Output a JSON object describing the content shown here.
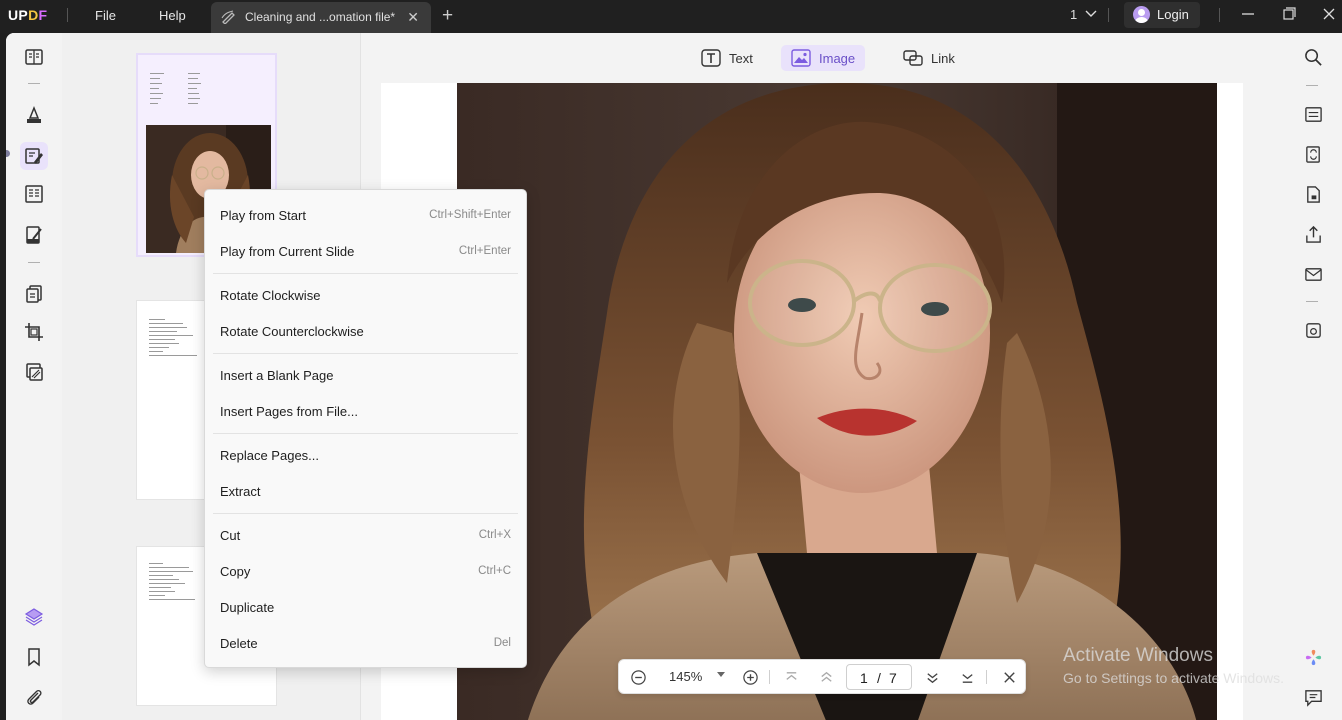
{
  "app": {
    "logo": [
      "U",
      "P",
      "D",
      "F"
    ]
  },
  "menu": {
    "file": "File",
    "help": "Help"
  },
  "tab": {
    "title": "Cleaning and ...omation file*"
  },
  "window": {
    "count": "1",
    "login": "Login"
  },
  "edit_toolbar": {
    "text": "Text",
    "image": "Image",
    "link": "Link",
    "active": "Image"
  },
  "context_menu": {
    "items": [
      {
        "label": "Play from Start",
        "shortcut": "Ctrl+Shift+Enter"
      },
      {
        "label": "Play from Current Slide",
        "shortcut": "Ctrl+Enter"
      },
      {
        "label": "Rotate Clockwise",
        "shortcut": ""
      },
      {
        "label": "Rotate Counterclockwise",
        "shortcut": ""
      },
      {
        "label": "Insert a Blank Page",
        "shortcut": ""
      },
      {
        "label": "Insert Pages from File...",
        "shortcut": ""
      },
      {
        "label": "Replace Pages...",
        "shortcut": ""
      },
      {
        "label": "Extract",
        "shortcut": ""
      },
      {
        "label": "Cut",
        "shortcut": "Ctrl+X"
      },
      {
        "label": "Copy",
        "shortcut": "Ctrl+C"
      },
      {
        "label": "Duplicate",
        "shortcut": ""
      },
      {
        "label": "Delete",
        "shortcut": "Del"
      }
    ]
  },
  "zoom_bar": {
    "zoom": "145%",
    "current_page": "1",
    "separator": "/",
    "total_pages": "7"
  },
  "watermark": {
    "line1": "Activate Windows",
    "line2": "Go to Settings to activate Windows."
  },
  "colors": {
    "accent": "#7c5ce0",
    "accent_bg": "#e9e2fb",
    "titlebar": "#202020"
  }
}
